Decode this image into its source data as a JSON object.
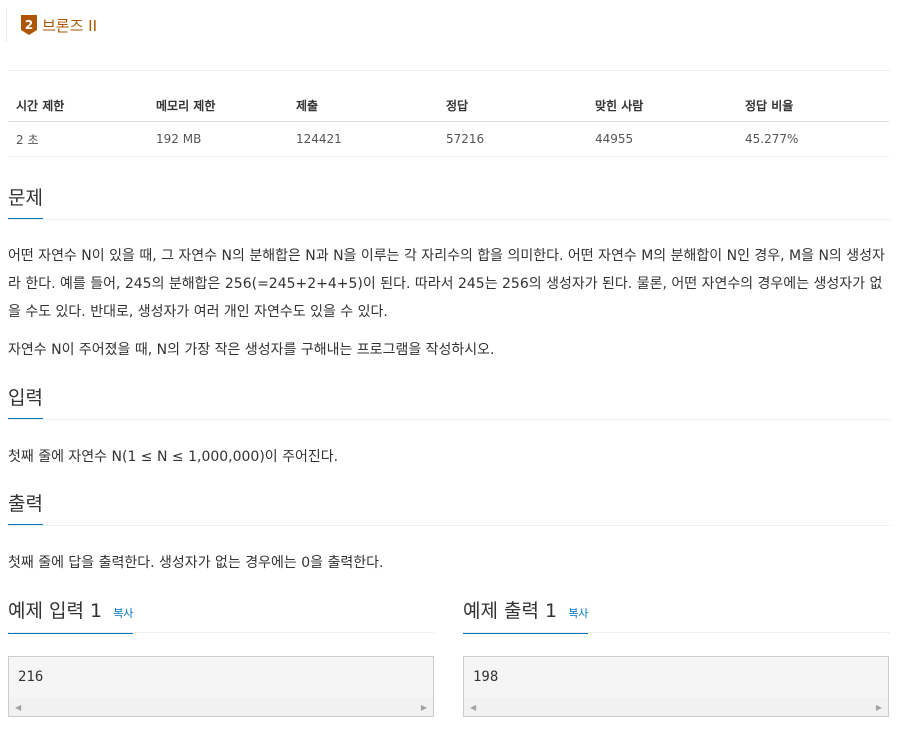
{
  "tier": {
    "number": "2",
    "label": "브론즈 II",
    "color": "#ad5600"
  },
  "info_table": {
    "headers": [
      "시간 제한",
      "메모리 제한",
      "제출",
      "정답",
      "맞힌 사람",
      "정답 비율"
    ],
    "values": [
      "2 초",
      "192 MB",
      "124421",
      "57216",
      "44955",
      "45.277%"
    ]
  },
  "sections": {
    "problem": {
      "title": "문제",
      "paragraphs": [
        "어떤 자연수 N이 있을 때, 그 자연수 N의 분해합은 N과 N을 이루는 각 자리수의 합을 의미한다. 어떤 자연수 M의 분해합이 N인 경우, M을 N의 생성자라 한다. 예를 들어, 245의 분해합은 256(=245+2+4+5)이 된다. 따라서 245는 256의 생성자가 된다. 물론, 어떤 자연수의 경우에는 생성자가 없을 수도 있다. 반대로, 생성자가 여러 개인 자연수도 있을 수 있다.",
        "자연수 N이 주어졌을 때, N의 가장 작은 생성자를 구해내는 프로그램을 작성하시오."
      ]
    },
    "input": {
      "title": "입력",
      "text": "첫째 줄에 자연수 N(1 ≤ N ≤ 1,000,000)이 주어진다."
    },
    "output": {
      "title": "출력",
      "text": "첫째 줄에 답을 출력한다. 생성자가 없는 경우에는 0을 출력한다."
    }
  },
  "samples": {
    "input": {
      "title": "예제 입력 1",
      "copy_label": "복사",
      "value": "216"
    },
    "output": {
      "title": "예제 출력 1",
      "copy_label": "복사",
      "value": "198"
    }
  },
  "scroll_icons": {
    "left": "◀",
    "right": "▶"
  },
  "colors": {
    "accent": "#0076c0",
    "bronze": "#ad5600"
  }
}
